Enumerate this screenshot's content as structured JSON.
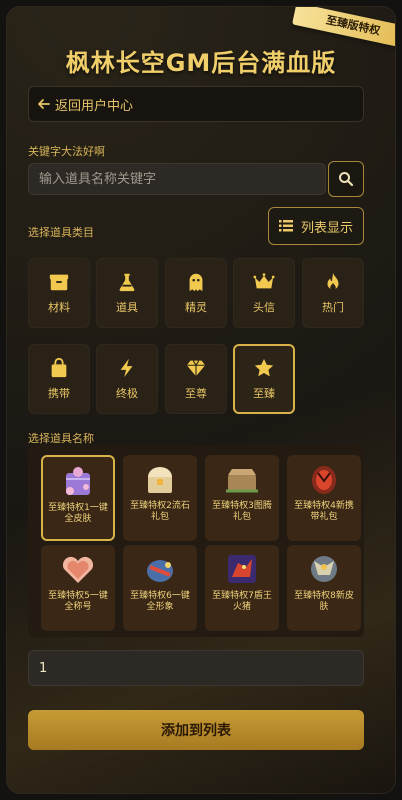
{
  "header": {
    "ribbon": "至臻版特权",
    "title": "枫林长空GM后台满血版"
  },
  "nav": {
    "back_label": "返回用户中心"
  },
  "search": {
    "label": "关键字大法好啊",
    "placeholder": "输入道具名称关键字",
    "value": ""
  },
  "categories": {
    "label": "选择道具类目",
    "view_toggle_label": "列表显示",
    "items": [
      {
        "label": "材料",
        "icon": "box-icon"
      },
      {
        "label": "道具",
        "icon": "flask-icon"
      },
      {
        "label": "精灵",
        "icon": "ghost-icon"
      },
      {
        "label": "头信",
        "icon": "crown-icon"
      },
      {
        "label": "热门",
        "icon": "fire-icon"
      },
      {
        "label": "携带",
        "icon": "bag-icon"
      },
      {
        "label": "终极",
        "icon": "bolt-icon"
      },
      {
        "label": "至尊",
        "icon": "gem-icon"
      },
      {
        "label": "至臻",
        "icon": "star-icon",
        "selected": true
      }
    ]
  },
  "items": {
    "label": "选择道具名称",
    "list": [
      {
        "name": "至臻特权1一键全皮肤",
        "selected": true
      },
      {
        "name": "至臻特权2流石礼包"
      },
      {
        "name": "至臻特权3图腾礼包"
      },
      {
        "name": "至臻特权4新携带礼包"
      },
      {
        "name": "至臻特权5一键全称号"
      },
      {
        "name": "至臻特权6一键全形象"
      },
      {
        "name": "至臻特权7盾王火猪"
      },
      {
        "name": "至臻特权8新皮肤"
      }
    ]
  },
  "quantity": {
    "value": "1"
  },
  "submit": {
    "label": "添加到列表"
  },
  "colors": {
    "accent": "#e8c25c",
    "panel": "#1b1813",
    "button": "#b58a2c"
  }
}
